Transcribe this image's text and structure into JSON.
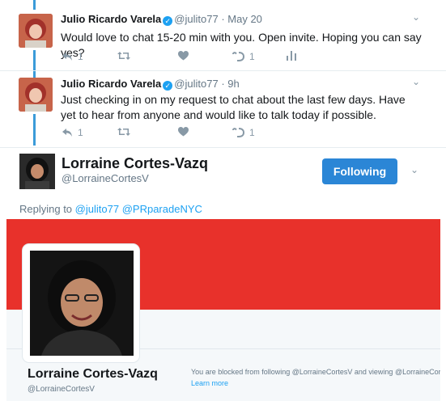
{
  "tweets": [
    {
      "name": "Julio Ricardo Varela",
      "handle": "@julito77",
      "time": "May 20",
      "text": "Would love to chat 15-20 min with you. Open invite. Hoping you can say yes?",
      "reply_count": "1",
      "retweet_count": "",
      "like_count": "",
      "dm_count": "1"
    },
    {
      "name": "Julio Ricardo Varela",
      "handle": "@julito77",
      "time": "9h",
      "text": "Just checking in on my request to chat about the last few days. Have yet to hear from anyone and would like to talk today if possible.",
      "reply_count": "1",
      "retweet_count": "",
      "like_count": "",
      "dm_count": "1"
    }
  ],
  "separator": "·",
  "verified_glyph": "✓",
  "reply_author": {
    "name": "Lorraine Cortes-Vazq",
    "handle": "@LorraineCortesV",
    "follow_label": "Following"
  },
  "replying": {
    "prefix": "Replying to",
    "mention_1": "@julito77",
    "mention_2": "@PRparadeNYC"
  },
  "profile_card": {
    "name": "Lorraine Cortes-Vazq",
    "handle": "@LorraineCortesV",
    "blocked_message": "You are blocked from following @LorraineCortesV and viewing @LorraineCortesV's Tweets.",
    "learn_more": "Learn more",
    "banner_color": "#e8312b"
  },
  "colors": {
    "accent": "#1da1f2",
    "thread": "#3b9bd9",
    "button": "#2b86d6"
  }
}
